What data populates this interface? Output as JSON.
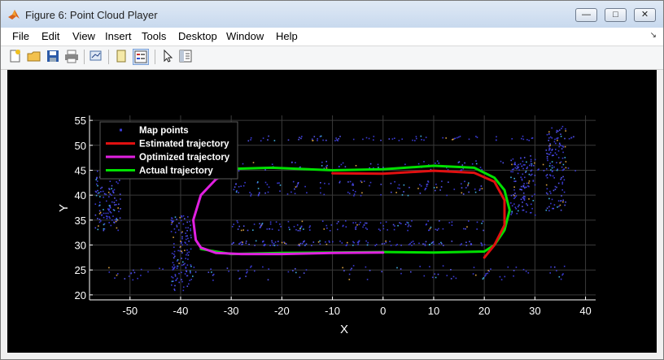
{
  "window": {
    "title": "Figure 6: Point Cloud Player",
    "controls": [
      "minimize",
      "maximize",
      "close"
    ]
  },
  "menu": [
    "File",
    "Edit",
    "View",
    "Insert",
    "Tools",
    "Desktop",
    "Window",
    "Help"
  ],
  "toolbar": {
    "buttons": [
      "new-figure-icon",
      "open-file-icon",
      "save-icon",
      "print-icon",
      "link-plot-icon",
      "hide-plot-tools-icon",
      "show-plot-tools-icon",
      "pointer-icon",
      "property-editor-icon"
    ]
  },
  "chart_data": {
    "type": "scatter",
    "title": "",
    "xlabel": "X",
    "ylabel": "Y",
    "xlim": [
      -58,
      42
    ],
    "ylim": [
      19,
      56
    ],
    "xticks": [
      "-50",
      "-40",
      "-30",
      "-20",
      "-10",
      "0",
      "10",
      "20",
      "30",
      "40"
    ],
    "yticks": [
      "20",
      "25",
      "30",
      "35",
      "40",
      "45",
      "50",
      "55"
    ],
    "grid": true,
    "background": "#000000",
    "legend": {
      "location": "top-left",
      "entries": [
        "Map points",
        "Estimated trajectory",
        "Optimized trajectory",
        "Actual trajectory"
      ]
    },
    "series": [
      {
        "name": "Map points",
        "kind": "points",
        "color": "#3b3bd6",
        "clusters": [
          {
            "x": [
              -55,
              38
            ],
            "y": [
              51,
              52
            ]
          },
          {
            "x": [
              -55,
              38
            ],
            "y": [
              45,
              47
            ]
          },
          {
            "x": [
              -30,
              20
            ],
            "y": [
              40,
              43
            ]
          },
          {
            "x": [
              -30,
              20
            ],
            "y": [
              33,
              35
            ]
          },
          {
            "x": [
              -30,
              20
            ],
            "y": [
              30,
              31
            ]
          },
          {
            "x": [
              -42,
              -38
            ],
            "y": [
              21,
              36
            ]
          },
          {
            "x": [
              -55,
              38
            ],
            "y": [
              23,
              26
            ]
          },
          {
            "x": [
              25,
              30
            ],
            "y": [
              36,
              48
            ]
          },
          {
            "x": [
              32,
              36
            ],
            "y": [
              37,
              54
            ]
          },
          {
            "x": [
              -57,
              -52
            ],
            "y": [
              33,
              45
            ]
          }
        ]
      },
      {
        "name": "Estimated trajectory",
        "color": "#e01010",
        "x": [
          -10,
          0,
          10,
          18,
          22,
          24,
          24,
          22,
          20
        ],
        "y": [
          44.4,
          44.3,
          44.9,
          44.5,
          42.7,
          39.0,
          34.0,
          30.0,
          27.5
        ]
      },
      {
        "name": "Optimized trajectory",
        "color": "#e020e0",
        "x": [
          -30,
          -33,
          -36,
          -37.5,
          -37,
          -36,
          -33,
          -28,
          -20,
          -10,
          0
        ],
        "y": [
          44.8,
          43.2,
          40.0,
          35.0,
          31.0,
          29.5,
          28.4,
          28.2,
          28.2,
          28.4,
          28.5
        ]
      },
      {
        "name": "Actual trajectory",
        "color": "#00e000",
        "x": [
          -29,
          -22,
          -10,
          0,
          10,
          18,
          22,
          24,
          25,
          24,
          22,
          20,
          10,
          0,
          -10,
          -20,
          -30,
          -36
        ],
        "y": [
          45.3,
          45.5,
          45.0,
          45.2,
          45.9,
          45.5,
          43.5,
          41.0,
          37.0,
          33.0,
          30.0,
          28.7,
          28.5,
          28.6,
          28.5,
          28.4,
          28.2,
          29.2
        ]
      }
    ]
  }
}
